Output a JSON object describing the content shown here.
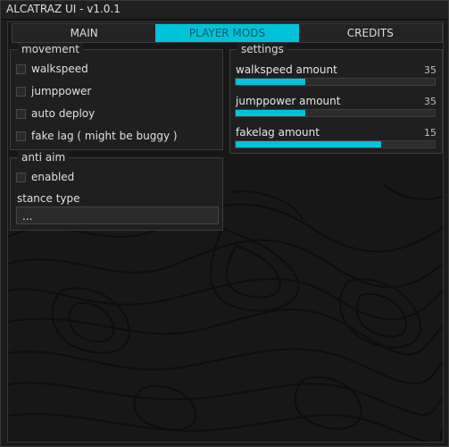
{
  "window": {
    "title": "ALCATRAZ UI - v1.0.1"
  },
  "tabs": [
    {
      "label": "MAIN",
      "active": false
    },
    {
      "label": "PLAYER MODS",
      "active": true
    },
    {
      "label": "CREDITS",
      "active": false
    }
  ],
  "movement": {
    "title": "movement",
    "options": [
      {
        "label": "walkspeed",
        "checked": false
      },
      {
        "label": "jumppower",
        "checked": false
      },
      {
        "label": "auto deploy",
        "checked": false
      },
      {
        "label": "fake lag ( might be buggy )",
        "checked": false
      }
    ]
  },
  "anti_aim": {
    "title": "anti aim",
    "enabled_label": "enabled",
    "enabled_checked": false,
    "stance_label": "stance type",
    "stance_value": "..."
  },
  "settings": {
    "title": "settings",
    "sliders": [
      {
        "label": "walkspeed amount",
        "value": "35",
        "fill_fraction": 0.35
      },
      {
        "label": "jumppower amount",
        "value": "35",
        "fill_fraction": 0.35
      },
      {
        "label": "fakelag amount",
        "value": "15",
        "fill_fraction": 0.73
      }
    ]
  },
  "colors": {
    "accent": "#00c2d9",
    "background": "#1b1b1b",
    "panel": "#1f1f1f",
    "text": "#e0e0e0"
  }
}
